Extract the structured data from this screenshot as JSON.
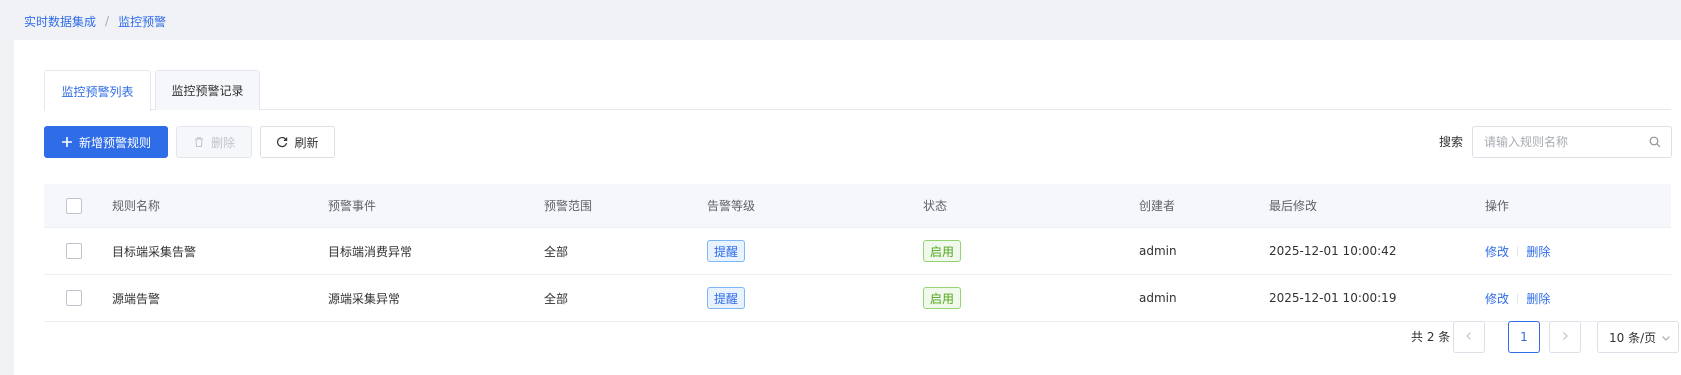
{
  "breadcrumb": {
    "items": [
      "实时数据集成",
      "监控预警"
    ],
    "separator": "/"
  },
  "tabs": [
    {
      "label": "监控预警列表",
      "active": true
    },
    {
      "label": "监控预警记录",
      "active": false
    }
  ],
  "toolbar": {
    "add_label": "新增预警规则",
    "delete_label": "删除",
    "refresh_label": "刷新",
    "search_label": "搜索",
    "search_placeholder": "请输入规则名称"
  },
  "table": {
    "columns": [
      "规则名称",
      "预警事件",
      "预警范围",
      "告警等级",
      "状态",
      "创建者",
      "最后修改",
      "操作"
    ],
    "rows": [
      {
        "name": "目标端采集告警",
        "event": "目标端消费异常",
        "scope": "全部",
        "level": "提醒",
        "status": "启用",
        "creator": "admin",
        "modified": "2025-12-01 10:00:42",
        "edit": "修改",
        "delete": "删除"
      },
      {
        "name": "源端告警",
        "event": "源端采集异常",
        "scope": "全部",
        "level": "提醒",
        "status": "启用",
        "creator": "admin",
        "modified": "2025-12-01 10:00:19",
        "edit": "修改",
        "delete": "删除"
      }
    ]
  },
  "pagination": {
    "total_text": "共 2 条",
    "current_page": "1",
    "page_size": "10 条/页"
  },
  "colors": {
    "primary": "#2f6ce8",
    "tag_blue_bg": "#e8f3ff",
    "tag_green": "#52a61e"
  },
  "icons": {
    "add": "plus-icon",
    "delete": "trash-icon",
    "refresh": "refresh-icon",
    "search": "search-icon",
    "prev": "chevron-left-icon",
    "next": "chevron-right-icon",
    "size": "chevron-down-icon"
  }
}
